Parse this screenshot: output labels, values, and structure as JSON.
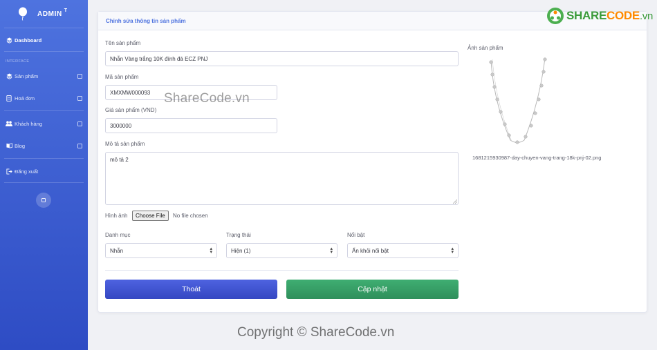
{
  "sidebar": {
    "brand": "ADMIN",
    "brand_sup": "T",
    "dashboard": "Dashboard",
    "heading": "INTERFACE",
    "items": [
      {
        "label": "Sản phẩm"
      },
      {
        "label": "Hoá đơn"
      },
      {
        "label": "Khách hàng"
      },
      {
        "label": "Blog"
      }
    ],
    "logout": "Đăng xuất"
  },
  "card": {
    "title": "Chỉnh sửa thông tin sản phẩm"
  },
  "form": {
    "name_label": "Tên sản phẩm",
    "name_value": "Nhẫn Vàng trắng 10K đính đá ECZ PNJ",
    "code_label": "Mã sản phẩm",
    "code_value": "XMXMW000093",
    "price_label": "Giá sản phẩm (VND)",
    "price_value": "3000000",
    "desc_label": "Mô tả sản phẩm",
    "desc_value": "mô tả 2",
    "image_label": "Hình ảnh",
    "file_button": "Choose File",
    "file_status": "No file chosen",
    "category_label": "Danh mục",
    "category_value": "Nhẫn",
    "status_label": "Trạng thái",
    "status_value": "Hiện (1)",
    "featured_label": "Nổi bật",
    "featured_value": "Ẩn khỏi nổi bật",
    "exit_button": "Thoát",
    "update_button": "Cập nhật"
  },
  "preview": {
    "label": "Ảnh sản phẩm",
    "filename": "1681215930987-day-chuyen-vang-trang-18k-pnj-02.png"
  },
  "watermark": {
    "logo_share": "SHARE",
    "logo_code": "CODE",
    "logo_vn": ".vn",
    "center": "ShareCode.vn",
    "copyright": "Copyright © ShareCode.vn"
  },
  "colors": {
    "sidebar": "#4e73df",
    "exit": "#3f55d4",
    "update": "#38a169",
    "title": "#4e73df"
  }
}
